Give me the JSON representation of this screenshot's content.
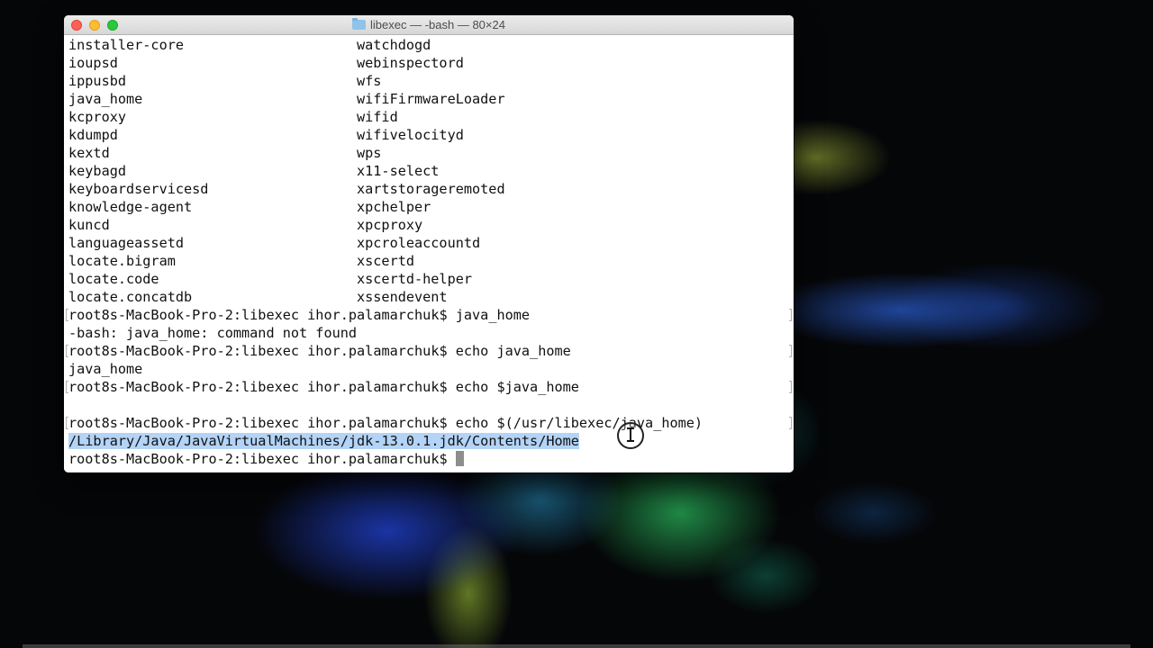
{
  "window": {
    "title": "libexec — -bash — 80×24"
  },
  "terminal": {
    "listing_left": [
      "installer-core",
      "ioupsd",
      "ippusbd",
      "java_home",
      "kcproxy",
      "kdumpd",
      "kextd",
      "keybagd",
      "keyboardservicesd",
      "knowledge-agent",
      "kuncd",
      "languageassetd",
      "locate.bigram",
      "locate.code",
      "locate.concatdb"
    ],
    "listing_right": [
      "watchdogd",
      "webinspectord",
      "wfs",
      "wifiFirmwareLoader",
      "wifid",
      "wifivelocityd",
      "wps",
      "x11-select",
      "xartstorageremoted",
      "xpchelper",
      "xpcproxy",
      "xpcroleaccountd",
      "xscertd",
      "xscertd-helper",
      "xssendevent"
    ],
    "session": [
      "root8s-MacBook-Pro-2:libexec ihor.palamarchuk$ java_home",
      "-bash: java_home: command not found",
      "root8s-MacBook-Pro-2:libexec ihor.palamarchuk$ echo java_home",
      "java_home",
      "root8s-MacBook-Pro-2:libexec ihor.palamarchuk$ echo $java_home",
      "",
      "root8s-MacBook-Pro-2:libexec ihor.palamarchuk$ echo $(/usr/libexec/java_home)"
    ],
    "selected_output": "/Library/Java/JavaVirtualMachines/jdk-13.0.1.jdk/Contents/Home",
    "current_prompt": "root8s-MacBook-Pro-2:libexec ihor.palamarchuk$ "
  },
  "colors": {
    "selection": "#b3d4f7",
    "cursor": "#8e8e8e"
  }
}
